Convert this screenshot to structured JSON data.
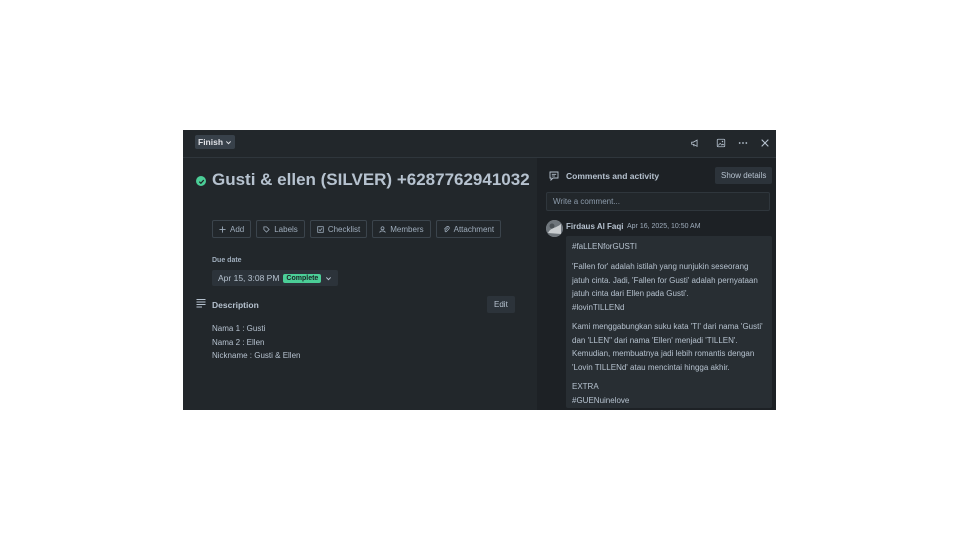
{
  "header": {
    "list_label": "Finish"
  },
  "card": {
    "title": "Gusti & ellen (SILVER) +6287762941032",
    "actions": [
      "Add",
      "Labels",
      "Checklist",
      "Members",
      "Attachment"
    ],
    "due_date": {
      "label": "Due date",
      "value": "Apr 15, 3:08 PM",
      "status": "Complete"
    },
    "description": {
      "title": "Description",
      "edit_label": "Edit",
      "lines": [
        "Nama 1 : Gusti",
        "Nama 2 : Ellen",
        "Nickname : Gusti & Ellen"
      ]
    }
  },
  "activity": {
    "title": "Comments and activity",
    "show_details_label": "Show details",
    "comment_placeholder": "Write a comment...",
    "comment": {
      "author": "Firdaus Al Faqi",
      "time": "Apr 16, 2025, 10:50 AM",
      "paragraphs": [
        [
          "#faLLENforGUSTI"
        ],
        [
          "'Fallen for' adalah istilah yang nunjukin seseorang",
          "jatuh cinta. Jadi, 'Fallen for Gusti' adalah pernyataan",
          "jatuh cinta dari Ellen pada Gusti'.",
          "#lovinTILLENd"
        ],
        [
          "Kami menggabungkan suku kata 'TI' dari nama 'Gusti'",
          "dan 'LLEN\" dari nama 'Ellen' menjadi 'TILLEN'.",
          "Kemudian, membuatnya jadi lebih romantis dengan",
          "'Lovin TILLENd' atau mencintai hingga akhir."
        ],
        [
          "EXTRA",
          "#GUENuinelove"
        ]
      ]
    }
  },
  "icons": {
    "status": "check-circle-icon",
    "description": "description-lines-icon",
    "activity": "comment-icon"
  },
  "colors": {
    "modal_bg": "#22272b",
    "panel_bg": "#1d2125",
    "complete": "#4bce97",
    "text": "#b6c2cf"
  }
}
